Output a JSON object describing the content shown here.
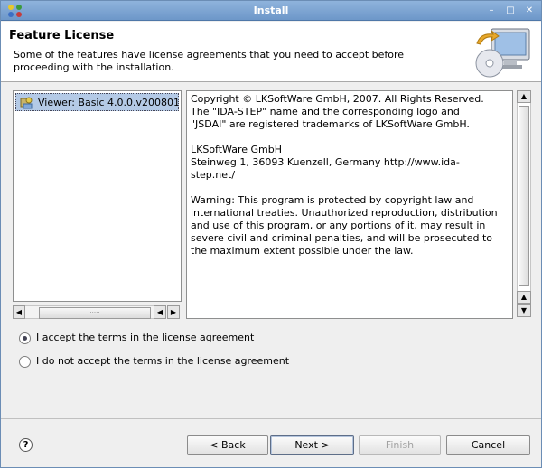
{
  "window": {
    "title": "Install",
    "controls": {
      "minimize": "–",
      "maximize": "□",
      "close": "✕"
    }
  },
  "header": {
    "title": "Feature License",
    "description": "Some of the features have license agreements that you need to accept before proceeding with the installation.",
    "graphic": "install-wizard-graphic"
  },
  "features": {
    "items": [
      {
        "label": "Viewer: Basic 4.0.0.v200801",
        "icon": "feature-icon",
        "selected": true
      }
    ]
  },
  "license": {
    "text": "Copyright © LKSoftWare GmbH, 2007. All Rights Reserved.\nThe \"IDA-STEP\" name and the corresponding logo and\n\"JSDAI\" are registered trademarks of LKSoftWare GmbH.\n\nLKSoftWare GmbH\nSteinweg 1, 36093 Kuenzell, Germany http://www.ida-\nstep.net/\n\nWarning: This program is protected by copyright law and\ninternational treaties. Unauthorized reproduction, distribution\nand use of this program, or any portions of it, may result in\nsevere civil and criminal penalties, and will be prosecuted to\nthe maximum extent possible under the law."
  },
  "options": {
    "accept": {
      "label": "I accept the terms in the license agreement",
      "checked": true
    },
    "decline": {
      "label": "I do not accept the terms in the license agreement",
      "checked": false
    }
  },
  "buttons": {
    "help": "?",
    "back": "< Back",
    "next": "Next >",
    "finish": "Finish",
    "cancel": "Cancel"
  },
  "scroll_glyphs": {
    "left": "◀",
    "right": "▶",
    "up": "▲",
    "down": "▼",
    "grip": "·····"
  }
}
